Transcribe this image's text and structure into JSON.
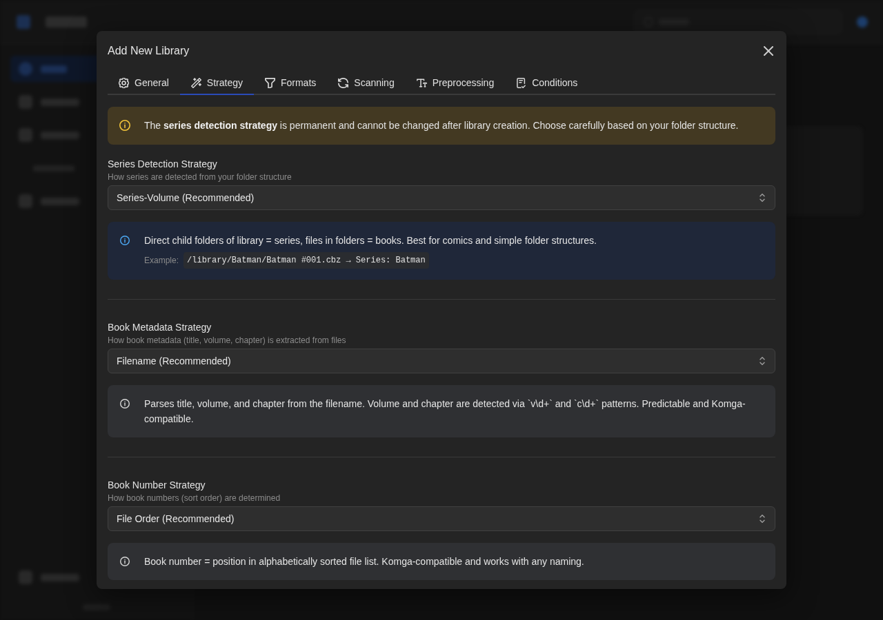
{
  "dialog": {
    "title": "Add New Library",
    "tabs": [
      {
        "label": "General",
        "selected": false
      },
      {
        "label": "Strategy",
        "selected": true
      },
      {
        "label": "Formats",
        "selected": false
      },
      {
        "label": "Scanning",
        "selected": false
      },
      {
        "label": "Preprocessing",
        "selected": false
      },
      {
        "label": "Conditions",
        "selected": false
      }
    ],
    "alert": {
      "text": "The **series detection strategy** is permanent and cannot be changed after library creation. Choose carefully based on your folder structure."
    },
    "sections": [
      {
        "label": "Series Detection Strategy",
        "description": "How series are detected from your folder structure",
        "value": "Series-Volume (Recommended)",
        "info": {
          "kind": "highlight",
          "text": "Direct child folders of library = series, files in folders = books. Best for comics and simple folder structures.",
          "example_label": "Example:",
          "example": "/library/Batman/Batman #001.cbz → Series: Batman"
        }
      },
      {
        "label": "Book Metadata Strategy",
        "description": "How book metadata (title, volume, chapter) is extracted from files",
        "value": "Filename (Recommended)",
        "info": {
          "kind": "neutral",
          "text": "Parses title, volume, and chapter from the filename. Volume and chapter are detected via `v\\d+` and `c\\d+` patterns. Predictable and Komga-compatible."
        }
      },
      {
        "label": "Book Number Strategy",
        "description": "How book numbers (sort order) are determined",
        "value": "File Order (Recommended)",
        "info": {
          "kind": "neutral",
          "text": "Book number = position in alphabetically sorted file list. Komga-compatible and works with any naming."
        }
      }
    ]
  }
}
